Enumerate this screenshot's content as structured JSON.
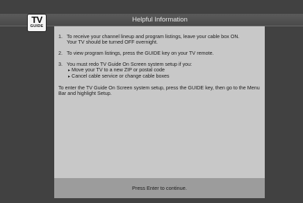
{
  "header": {
    "logo_top": "TV",
    "logo_bottom": "GUIDE",
    "title": "Helpful Information"
  },
  "info": {
    "items": [
      {
        "num": "1.",
        "line1": "To receive your channel lineup and program listings, leave your cable box ON.",
        "line2": "Your TV should be turned OFF overnight."
      },
      {
        "num": "2.",
        "line1": "To view program listings, press the GUIDE key on your TV remote."
      },
      {
        "num": "3.",
        "line1": "You must redo TV Guide On Screen system setup if you:",
        "bullets": [
          "Move your TV to a new ZIP or postal code",
          "Cancel cable service or change cable boxes"
        ]
      }
    ],
    "closing": "To enter the TV Guide On Screen system setup, press the GUIDE key, then go to the Menu Bar and highlight Setup."
  },
  "footer": {
    "prompt": "Press Enter to continue."
  }
}
